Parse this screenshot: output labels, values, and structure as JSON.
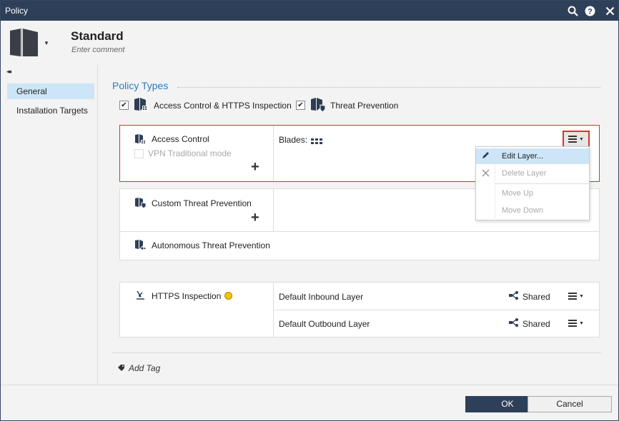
{
  "window": {
    "title": "Policy"
  },
  "header": {
    "title": "Standard",
    "comment_placeholder": "Enter comment"
  },
  "sidebar": {
    "items": [
      {
        "label": "General",
        "selected": true
      },
      {
        "label": "Installation Targets",
        "selected": false
      }
    ]
  },
  "policy_types": {
    "heading": "Policy Types",
    "types": [
      {
        "label": "Access Control & HTTPS Inspection",
        "checked": true
      },
      {
        "label": "Threat Prevention",
        "checked": true
      }
    ]
  },
  "access_control": {
    "label": "Access Control",
    "vpn_label": "VPN Traditional mode",
    "vpn_checked": false,
    "blades_label": "Blades:"
  },
  "layer_menu": {
    "items": [
      {
        "label": "Edit Layer...",
        "enabled": true,
        "icon": "pencil-icon"
      },
      {
        "label": "Delete Layer",
        "enabled": false,
        "icon": "close-icon"
      },
      {
        "label": "Move Up",
        "enabled": false
      },
      {
        "label": "Move Down",
        "enabled": false
      }
    ]
  },
  "threat_prevention": {
    "custom_label": "Custom Threat Prevention",
    "autonomous_label": "Autonomous Threat Prevention"
  },
  "https_inspection": {
    "label": "HTTPS Inspection",
    "layers": [
      {
        "name": "Default Inbound Layer",
        "shared_label": "Shared"
      },
      {
        "name": "Default Outbound Layer",
        "shared_label": "Shared"
      }
    ]
  },
  "tags": {
    "add_label": "Add Tag"
  },
  "footer": {
    "ok_label": "OK",
    "cancel_label": "Cancel"
  },
  "colors": {
    "titlebar": "#2e4059",
    "accent": "#2b7bc4",
    "selection": "#cde6f7",
    "highlight_border": "#d9322d"
  }
}
